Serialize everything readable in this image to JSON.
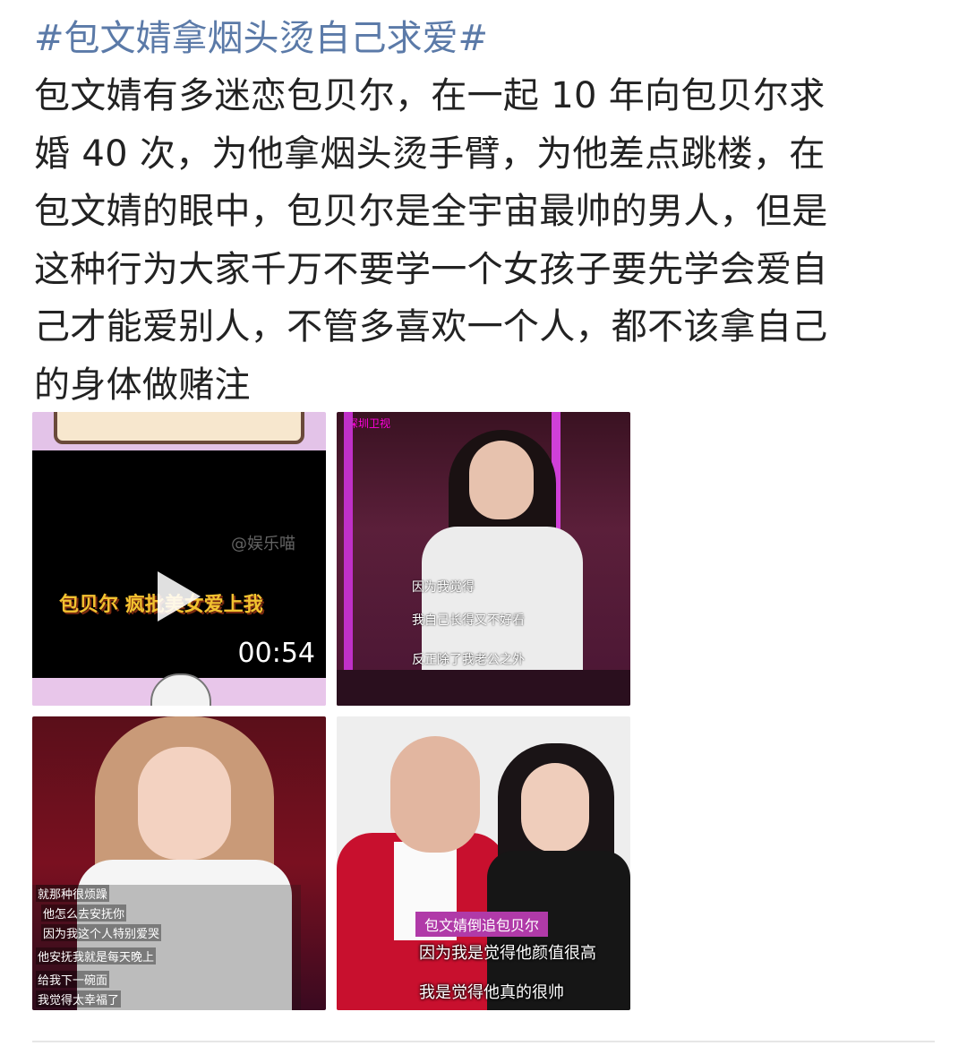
{
  "post": {
    "hashtag": "#包文婧拿烟头烫自己求爱#",
    "text": "包文婧有多迷恋包贝尔，在一起 10 年向包贝尔求\n婚 40 次，为他拿烟头烫手臂，为他差点跳楼，在\n包文婧的眼中，包贝尔是全宇宙最帅的男人，但是\n这种行为大家千万不要学一个女孩子要先学会爱自\n己才能爱别人，不管多喜欢一个人，都不该拿自己\n的身体做赌注"
  },
  "media": {
    "video": {
      "watermark": "@娱乐喵",
      "caption": "包贝尔 疯批美女爱上我",
      "duration": "00:54"
    },
    "photo2": {
      "logo": "深圳卫视",
      "subtitles": [
        "因为我觉得",
        "我自己长得又不好看",
        "反正除了我老公之外"
      ]
    },
    "photo3": {
      "subtitles": [
        "就那种很烦躁",
        "他怎么去安抚你",
        "因为我这个人特别爱哭",
        "他安抚我就是每天晚上",
        "给我下一碗面",
        "我觉得太幸福了"
      ]
    },
    "photo4": {
      "tag": "包文婧倒追包贝尔",
      "subtitles": [
        "因为我是觉得他颜值很高",
        "我是觉得他真的很帅"
      ]
    }
  }
}
